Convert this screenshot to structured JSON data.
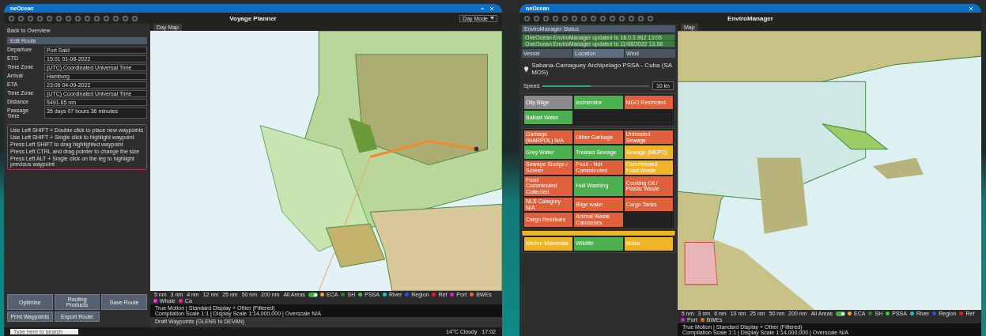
{
  "voyage_planner": {
    "brand": "neOcean",
    "title": "Voyage Planner",
    "mode": "Day Mode",
    "back": "Back to Overview",
    "section": "Edit Route",
    "fields": [
      {
        "label": "Departure",
        "value": "Port Said"
      },
      {
        "label": "ETD",
        "value": "15:01 01-08-2022"
      },
      {
        "label": "Time Zone",
        "value": "(UTC) Coordinated Universal Time"
      },
      {
        "label": "Arrival",
        "value": "Hamburg"
      },
      {
        "label": "ETA",
        "value": "23:09 04-09-2022"
      },
      {
        "label": "Time Zone",
        "value": "(UTC) Coordinated Universal Time"
      },
      {
        "label": "Distance",
        "value": "5491.65 nm"
      },
      {
        "label": "Passage Time",
        "value": "35 days 07 hours 36 minutes"
      }
    ],
    "instructions": [
      "Use Left SHIFT + Double click to place new waypoints",
      "Use Left SHIFT + Single click to highlight waypoint",
      "Press Left SHIFT to drag highlighted waypoint",
      "Press Left CTRL and drag pointer to change the size",
      "Press Left ALT + Single click on the leg to highlight previous waypoint"
    ],
    "buttons": [
      "Optimise",
      "Routing Products",
      "Save Route",
      "Print Waypoints",
      "Export Route"
    ],
    "map_tab": "Day Map",
    "ranges": [
      "5 nm",
      "3 nm",
      "4 nm",
      "12 nm",
      "25 nm",
      "50 nm",
      "200 nm"
    ],
    "all_areas": {
      "label": "All Areas",
      "on": true
    },
    "layers": [
      {
        "label": "ECA",
        "color": "#f0a030"
      },
      {
        "label": "SH",
        "color": "#2e7d32"
      },
      {
        "label": "PSSA",
        "color": "#3cc43c"
      },
      {
        "label": "River",
        "color": "#20c0c0"
      },
      {
        "label": "Region",
        "color": "#3050e0"
      },
      {
        "label": "Ref",
        "color": "#e02020"
      },
      {
        "label": "Port",
        "color": "#d020d0"
      },
      {
        "label": "BWEs",
        "color": "#e07020"
      },
      {
        "label": "Whale",
        "color": "#e040e0"
      },
      {
        "label": "Ca",
        "color": "#e03090"
      }
    ],
    "status": [
      "True Motion | Standard Display + Other (Filtered)",
      "Compilation Scale 1:1 | Display Scale 1:14,000,000 | Overscale N/A"
    ],
    "waypoints_title": "Draft Waypoints (GLENS to DEVAN)",
    "taskbar": {
      "search": "Type here to search",
      "weather": "14°C Cloudy",
      "time": "17:02"
    }
  },
  "enviro_manager": {
    "brand": "neOcean",
    "title": "EnviroManager",
    "status_title": "EnviroManager Status",
    "updates": [
      "OneOcean EnviroManager updated to 18.0.3.962 13:05",
      "OneOcean EnviroManager updated to 11/08/2022 13:58"
    ],
    "tabs": [
      {
        "label": "Vessel",
        "selected": false
      },
      {
        "label": "Location",
        "selected": true
      },
      {
        "label": "Wind",
        "selected": false
      }
    ],
    "area": "Sabana-Camaguey Archipelago PSSA - Cuba (SA MOS)",
    "speed_label": "Speed",
    "speed": {
      "level": 0.45
    },
    "speed_value": "10 kn",
    "groups": [
      [
        {
          "label": "Oily Bilge",
          "color": "#8a8a8a"
        },
        {
          "label": "Incinerator",
          "color": "#4caf50"
        },
        {
          "label": "MGO Restricted",
          "color": "#e0603c"
        },
        {
          "label": "Ballast Water",
          "color": "#4caf50"
        }
      ],
      [
        {
          "label": "Garbage (MARPOL) N/A",
          "color": "#e0603c"
        },
        {
          "label": "Other Garbage",
          "color": "#e0603c"
        },
        {
          "label": "Untreated Sewage",
          "color": "#e0603c"
        },
        {
          "label": "Grey Water",
          "color": "#4caf50"
        },
        {
          "label": "Treated Sewage",
          "color": "#4caf50"
        },
        {
          "label": "Sewage (MEPC)",
          "color": "#f0b429"
        },
        {
          "label": "Sewage Sludge / Screen",
          "color": "#e0603c"
        },
        {
          "label": "Food - Not Comminuted",
          "color": "#e0603c"
        },
        {
          "label": "Comminuted Food Waste",
          "color": "#f0b429"
        },
        {
          "label": "Food Comminuted Collected",
          "color": "#e0603c"
        },
        {
          "label": "Hull Washing",
          "color": "#4caf50"
        },
        {
          "label": "Cooking Oil / Plastic Waste",
          "color": "#e0603c"
        },
        {
          "label": "NLS Category N/A",
          "color": "#e0603c"
        },
        {
          "label": "Bilge water",
          "color": "#e0603c"
        },
        {
          "label": "Cargo Tanks",
          "color": "#e0603c"
        },
        {
          "label": "Cargo Residues",
          "color": "#e0603c"
        },
        {
          "label": "Animal Waste Carcasses",
          "color": "#e0603c"
        }
      ],
      [
        {
          "label": "Marine Mammals",
          "color": "#f0b429"
        },
        {
          "label": "Wildlife",
          "color": "#4caf50"
        },
        {
          "label": "Noise",
          "color": "#f0b429"
        }
      ]
    ],
    "map_tab": "Map",
    "ranges": [
      "5 nm",
      "3 nm",
      "6 nm",
      "10 nm",
      "25 nm",
      "50 nm",
      "200 nm"
    ],
    "all_areas": {
      "label": "All Areas",
      "on": true
    },
    "layers": [
      {
        "label": "ECA",
        "color": "#f0a030"
      },
      {
        "label": "SH",
        "color": "#2e7d32"
      },
      {
        "label": "PSSA",
        "color": "#3cc43c"
      },
      {
        "label": "River",
        "color": "#20c0c0"
      },
      {
        "label": "Region",
        "color": "#3050e0"
      },
      {
        "label": "Ref",
        "color": "#e02020"
      },
      {
        "label": "Port",
        "color": "#d020d0"
      },
      {
        "label": "BWEs",
        "color": "#e07020"
      }
    ],
    "status": [
      "True Motion | Standard Display + Other (Filtered)",
      "Compilation Scale 1:1 | Display Scale 1:14,000,000 | Overscale N/A"
    ]
  }
}
